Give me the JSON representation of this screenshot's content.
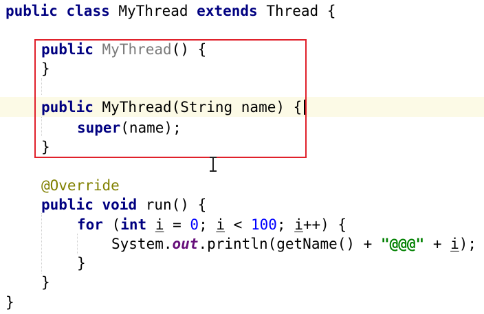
{
  "code": {
    "l1": {
      "kw1": "public",
      "kw2": "class",
      "name": " MyThread ",
      "kw3": "extends",
      "rest": " Thread {"
    },
    "l2": {
      "kw": "public",
      "ctor": "MyThread",
      "rest": "() {"
    },
    "l3": {
      "text": "}"
    },
    "l4": {
      "kw": "public",
      "rest": " MyThread(String name) {"
    },
    "l5": {
      "kw": "super",
      "rest": "(name);"
    },
    "l6": {
      "text": "}"
    },
    "l7": {
      "ann": "@Override"
    },
    "l8": {
      "kw1": "public",
      "kw2": "void",
      "rest": " run() {"
    },
    "l9": {
      "kw1": "for",
      "p1": " (",
      "kw2": "int",
      "sp": " ",
      "i1": "i",
      "p2": " = ",
      "n1": "0",
      "p3": "; ",
      "i2": "i",
      "p4": " < ",
      "n2": "100",
      "p5": "; ",
      "i3": "i",
      "p6": "++) {"
    },
    "l10": {
      "p1": "System.",
      "field": "out",
      "p2": ".println(getName() + ",
      "str": "\"@@@\"",
      "p3": " + ",
      "i": "i",
      "p4": ");"
    },
    "l11": {
      "text": "}"
    },
    "l12": {
      "text": "}"
    },
    "l13": {
      "text": "}"
    }
  }
}
